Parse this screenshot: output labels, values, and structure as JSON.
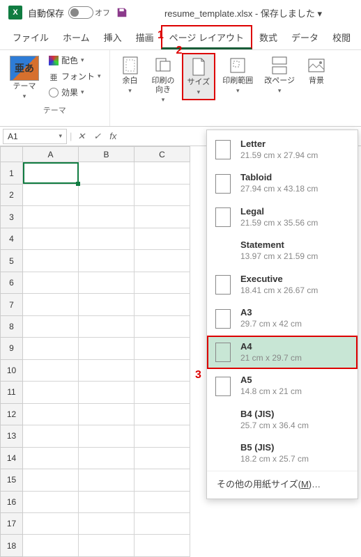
{
  "titlebar": {
    "autosave_label": "自動保存",
    "toggle_state": "オフ",
    "filename": "resume_template.xlsx - 保存しました ▾"
  },
  "annotations": {
    "a1": "1",
    "a2": "2",
    "a3": "3"
  },
  "tabs": {
    "file": "ファイル",
    "home": "ホーム",
    "insert": "挿入",
    "draw": "描画",
    "pagelayout": "ページ レイアウト",
    "formulas": "数式",
    "data": "データ",
    "review": "校閲"
  },
  "ribbon": {
    "themes_group": "テーマ",
    "themes_btn": "テーマ",
    "colors_menu": "配色",
    "fonts_menu": "フォント",
    "effects_menu": "効果",
    "margins": "余白",
    "orientation": "印刷の\n向き",
    "size": "サイズ",
    "print_area": "印刷範囲",
    "breaks": "改ページ",
    "background": "背景"
  },
  "fxbar": {
    "namebox": "A1"
  },
  "grid": {
    "cols": [
      "A",
      "B",
      "C"
    ],
    "rows": [
      "1",
      "2",
      "3",
      "4",
      "5",
      "6",
      "7",
      "8",
      "9",
      "10",
      "11",
      "12",
      "13",
      "14",
      "15",
      "16",
      "17",
      "18"
    ]
  },
  "paper_menu": {
    "items": [
      {
        "name": "Letter",
        "dim": "21.59 cm x 27.94 cm",
        "icon": true
      },
      {
        "name": "Tabloid",
        "dim": "27.94 cm x 43.18 cm",
        "icon": true
      },
      {
        "name": "Legal",
        "dim": "21.59 cm x 35.56 cm",
        "icon": true
      },
      {
        "name": "Statement",
        "dim": "13.97 cm x 21.59 cm",
        "icon": false
      },
      {
        "name": "Executive",
        "dim": "18.41 cm x 26.67 cm",
        "icon": true
      },
      {
        "name": "A3",
        "dim": "29.7 cm x 42 cm",
        "icon": true
      },
      {
        "name": "A4",
        "dim": "21 cm x 29.7 cm",
        "icon": true,
        "selected": true
      },
      {
        "name": "A5",
        "dim": "14.8 cm x 21 cm",
        "icon": true
      },
      {
        "name": "B4 (JIS)",
        "dim": "25.7 cm x 36.4 cm",
        "icon": false
      },
      {
        "name": "B5 (JIS)",
        "dim": "18.2 cm x 25.7 cm",
        "icon": false
      }
    ],
    "footer": "その他の用紙サイズ(M)…"
  }
}
